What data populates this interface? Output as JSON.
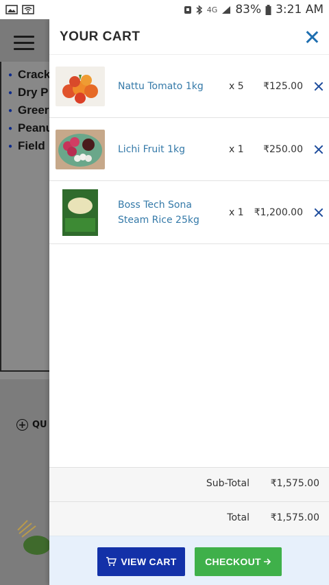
{
  "status_bar": {
    "battery": "83%",
    "time": "3:21 AM",
    "network": "4G"
  },
  "background": {
    "list_items": [
      "Crack",
      "Dry P",
      "Greer",
      "Peanu",
      "Field"
    ],
    "quick_label": "QU"
  },
  "cart": {
    "title": "YOUR CART",
    "items": [
      {
        "name": "Nattu Tomato 1kg",
        "qty": "x 5",
        "price": "₹125.00",
        "image": "tomatoes"
      },
      {
        "name": "Lichi Fruit 1kg",
        "qty": "x 1",
        "price": "₹250.00",
        "image": "lichi"
      },
      {
        "name": "Boss Tech Sona Steam Rice 25kg",
        "qty": "x 1",
        "price": "₹1,200.00",
        "image": "rice-bag"
      }
    ],
    "subtotal_label": "Sub-Total",
    "subtotal_value": "₹1,575.00",
    "total_label": "Total",
    "total_value": "₹1,575.00",
    "view_cart_label": "VIEW CART",
    "checkout_label": "CHECKOUT"
  },
  "colors": {
    "accent_blue": "#1331a8",
    "checkout_green": "#3fb04a",
    "link_blue": "#3479a8"
  }
}
